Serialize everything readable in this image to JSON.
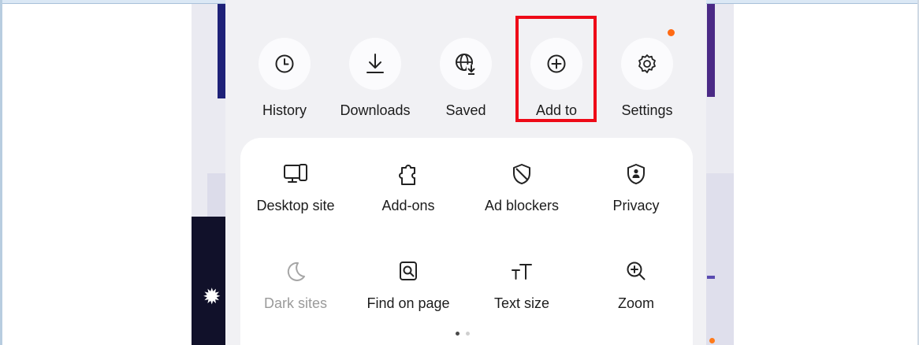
{
  "top_actions": [
    {
      "label": "History",
      "icon": "clock-icon"
    },
    {
      "label": "Downloads",
      "icon": "download-icon"
    },
    {
      "label": "Saved",
      "icon": "saved-globe-icon"
    },
    {
      "label": "Add to",
      "icon": "add-circle-icon"
    },
    {
      "label": "Settings",
      "icon": "gear-icon"
    }
  ],
  "grid_actions": [
    {
      "label": "Desktop site",
      "icon": "desktop-icon",
      "enabled": true
    },
    {
      "label": "Add-ons",
      "icon": "puzzle-icon",
      "enabled": true
    },
    {
      "label": "Ad blockers",
      "icon": "shield-block-icon",
      "enabled": true
    },
    {
      "label": "Privacy",
      "icon": "privacy-shield-icon",
      "enabled": true
    },
    {
      "label": "Dark sites",
      "icon": "moon-icon",
      "enabled": false
    },
    {
      "label": "Find on page",
      "icon": "find-page-icon",
      "enabled": true
    },
    {
      "label": "Text size",
      "icon": "text-size-icon",
      "enabled": true
    },
    {
      "label": "Zoom",
      "icon": "zoom-in-icon",
      "enabled": true
    }
  ],
  "pager": {
    "pages": 2,
    "current": 1
  },
  "colors": {
    "highlight": "#ee0a17",
    "badge": "#ff6a13",
    "panel": "#f1f1f4",
    "card": "#ffffff"
  }
}
